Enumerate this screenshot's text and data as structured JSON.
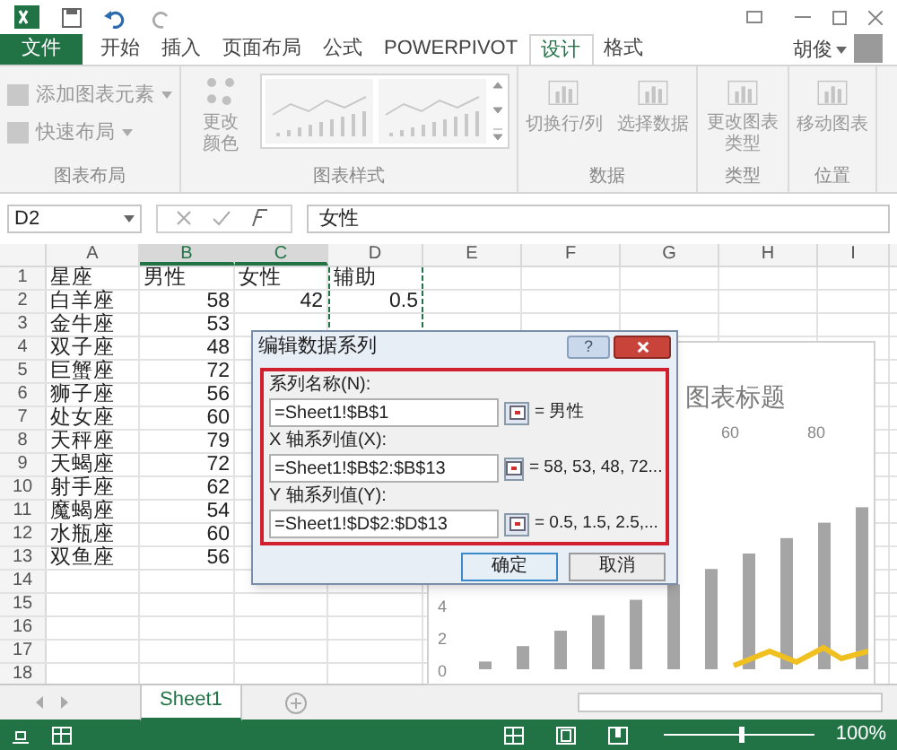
{
  "ribbon_tabs": [
    {
      "label": "文件",
      "kind": "file",
      "selected": false
    },
    {
      "label": "开始",
      "kind": "tab",
      "selected": false
    },
    {
      "label": "插入",
      "kind": "tab",
      "selected": false
    },
    {
      "label": "页面布局",
      "kind": "tab",
      "selected": false
    },
    {
      "label": "公式",
      "kind": "tab",
      "selected": false
    },
    {
      "label": "POWERPIVOT",
      "kind": "tab",
      "selected": false
    },
    {
      "label": "设计",
      "kind": "tab",
      "selected": true
    },
    {
      "label": "格式",
      "kind": "tab",
      "selected": false
    }
  ],
  "user": {
    "name": "胡俊"
  },
  "ribbon_groups": [
    {
      "label": "图表布局",
      "kind": "list",
      "items": [
        "添加图表元素",
        "快速布局"
      ]
    },
    {
      "label": "图表样式",
      "kind": "styles",
      "items": [
        "更改颜色"
      ]
    },
    {
      "label": "数据",
      "kind": "big",
      "items": [
        "切换行/列",
        "选择数据"
      ]
    },
    {
      "label": "类型",
      "kind": "big",
      "items": [
        "更改图表类型"
      ]
    },
    {
      "label": "位置",
      "kind": "big",
      "items": [
        "移动图表"
      ]
    }
  ],
  "formula_bar": {
    "name_box": "D2",
    "value": "女性"
  },
  "sheet": {
    "columns": [
      {
        "label": "A",
        "selected": false
      },
      {
        "label": "B",
        "selected": true
      },
      {
        "label": "C",
        "selected": true
      },
      {
        "label": "D",
        "selected": false
      },
      {
        "label": "E",
        "selected": false
      },
      {
        "label": "F",
        "selected": false
      },
      {
        "label": "G",
        "selected": false
      },
      {
        "label": "H",
        "selected": false
      },
      {
        "label": "I",
        "selected": false
      }
    ],
    "rows": [
      {
        "number": "1",
        "cells": [
          "星座",
          "男性",
          "女性",
          "辅助"
        ]
      },
      {
        "number": "2",
        "cells": [
          "白羊座",
          "58",
          "42",
          "0.5"
        ]
      },
      {
        "number": "3",
        "cells": [
          "金牛座",
          "53"
        ]
      },
      {
        "number": "4",
        "cells": [
          "双子座",
          "48"
        ]
      },
      {
        "number": "5",
        "cells": [
          "巨蟹座",
          "72"
        ]
      },
      {
        "number": "6",
        "cells": [
          "狮子座",
          "56"
        ]
      },
      {
        "number": "7",
        "cells": [
          "处女座",
          "60"
        ]
      },
      {
        "number": "8",
        "cells": [
          "天秤座",
          "79"
        ]
      },
      {
        "number": "9",
        "cells": [
          "天蝎座",
          "72"
        ]
      },
      {
        "number": "10",
        "cells": [
          "射手座",
          "62"
        ]
      },
      {
        "number": "11",
        "cells": [
          "魔蝎座",
          "54"
        ]
      },
      {
        "number": "12",
        "cells": [
          "水瓶座",
          "60"
        ]
      },
      {
        "number": "13",
        "cells": [
          "双鱼座",
          "56"
        ]
      },
      {
        "number": "14",
        "cells": []
      },
      {
        "number": "15",
        "cells": []
      },
      {
        "number": "16",
        "cells": []
      },
      {
        "number": "17",
        "cells": []
      },
      {
        "number": "18",
        "cells": []
      }
    ]
  },
  "chart": {
    "title": "图表标题",
    "top_axis_labels": [
      "60",
      "80"
    ],
    "left_axis_labels": [
      "4",
      "2",
      "0"
    ]
  },
  "dialog": {
    "title": "编辑数据系列",
    "help": "?",
    "fields": [
      {
        "label": "系列名称(N):",
        "value": "=Sheet1!$B$1",
        "preview": "= 男性"
      },
      {
        "label": "X 轴系列值(X):",
        "value": "=Sheet1!$B$2:$B$13",
        "preview": "= 58, 53, 48, 72..."
      },
      {
        "label": "Y 轴系列值(Y):",
        "value": "=Sheet1!$D$2:$D$13",
        "preview": "= 0.5, 1.5, 2.5,..."
      }
    ],
    "buttons": [
      {
        "label": "确定",
        "kind": "default"
      },
      {
        "label": "取消",
        "kind": "normal"
      }
    ]
  },
  "sheet_tabs": [
    {
      "label": "Sheet1",
      "selected": true
    }
  ],
  "status_bar": {
    "zoom": "100%",
    "level": 0.5
  }
}
